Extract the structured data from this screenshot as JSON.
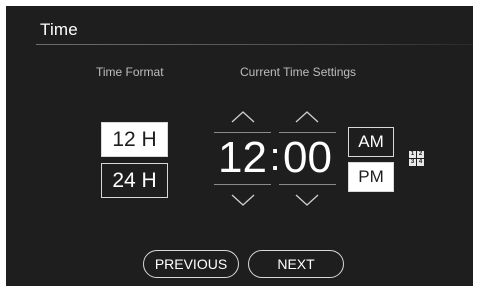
{
  "header": {
    "title": "Time"
  },
  "time_format": {
    "label": "Time Format",
    "options": [
      "12 H",
      "24 H"
    ],
    "selected": "12 H"
  },
  "current_time": {
    "label": "Current Time Settings",
    "hour": "12",
    "separator": ":",
    "minute": "00",
    "meridiem_options": [
      "AM",
      "PM"
    ],
    "meridiem_selected": "PM"
  },
  "keypad": {
    "icon": "numeric-keypad-icon",
    "digits": [
      "1",
      "2",
      "3",
      "4"
    ]
  },
  "footer": {
    "previous_label": "PREVIOUS",
    "next_label": "NEXT"
  },
  "colors": {
    "background": "#1e1e1e",
    "selected_fill": "#ffffff",
    "text": "#ffffff"
  }
}
